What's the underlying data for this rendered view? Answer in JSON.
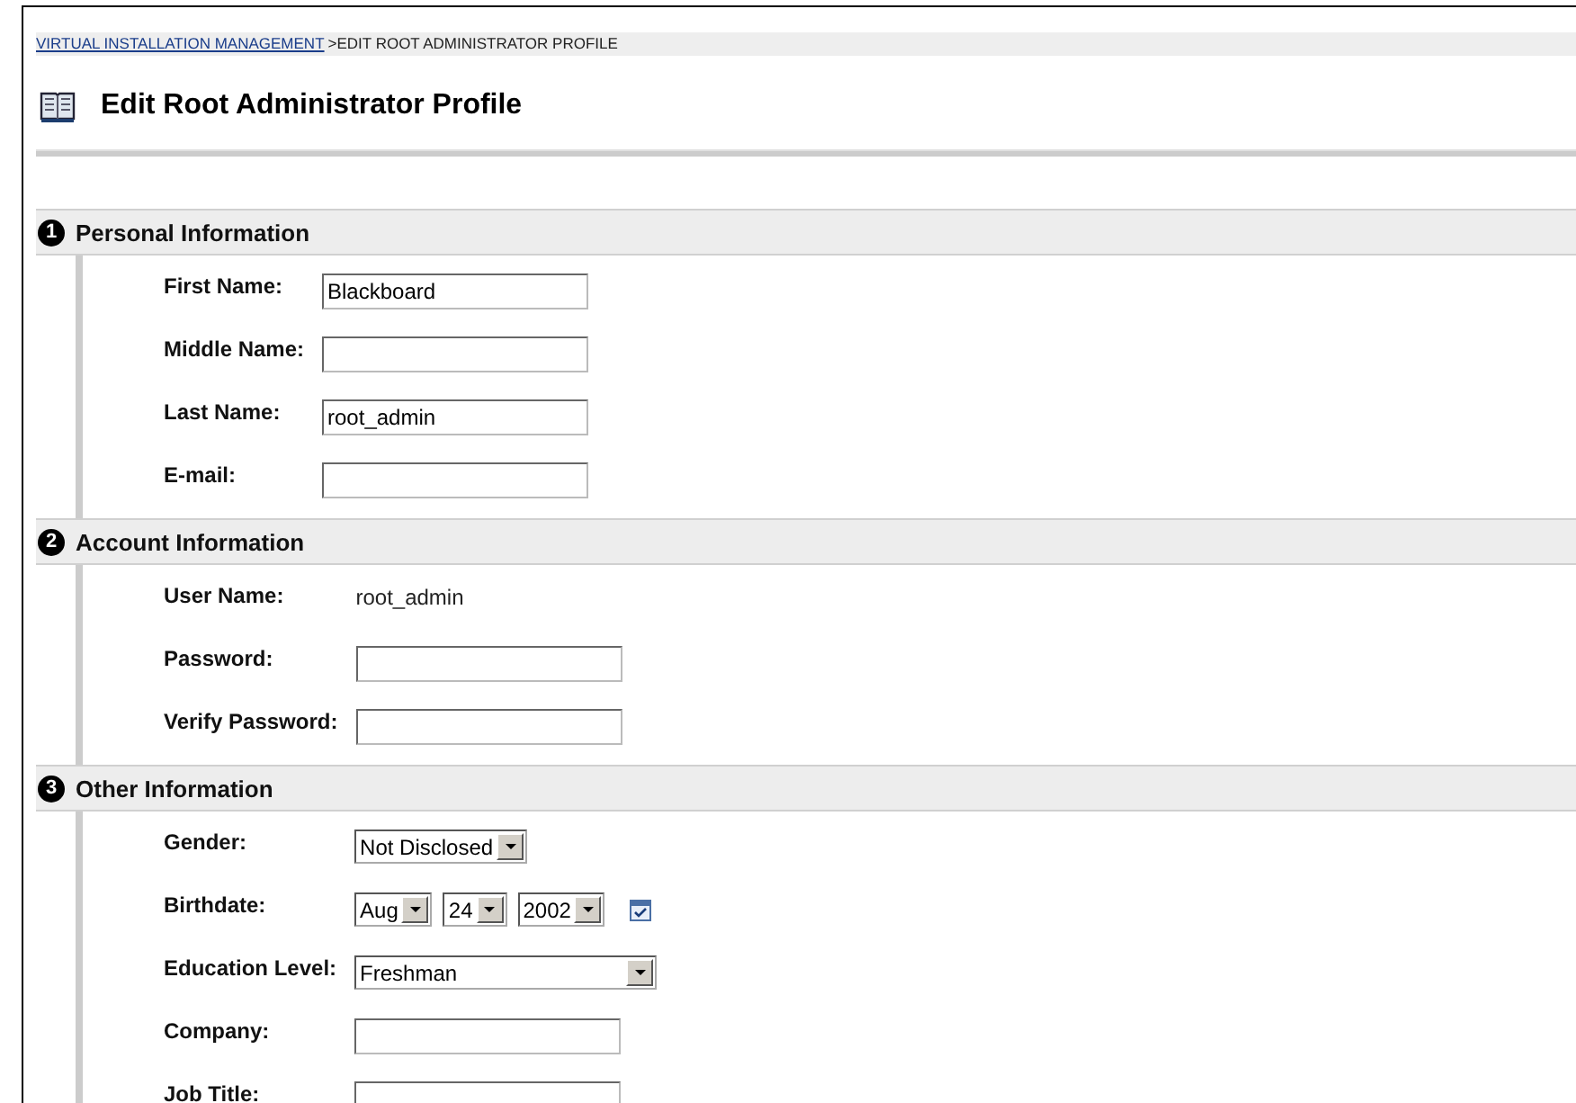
{
  "breadcrumb": {
    "link": "VIRTUAL INSTALLATION MANAGEMENT",
    "separator": ">",
    "current": "EDIT ROOT ADMINISTRATOR PROFILE"
  },
  "title": "Edit Root Administrator Profile",
  "sections": [
    {
      "number": "1",
      "title": "Personal Information",
      "rows": [
        {
          "kind": "text",
          "label": "First Name:",
          "value": "Blackboard"
        },
        {
          "kind": "text",
          "label": "Middle Name:"
        },
        {
          "kind": "text",
          "label": "Last Name:",
          "value": "root_admin"
        },
        {
          "kind": "text",
          "label": "E-mail:"
        }
      ]
    },
    {
      "number": "2",
      "title": "Account Information",
      "rows": [
        {
          "kind": "static",
          "label": "User Name:",
          "value": "root_admin"
        },
        {
          "kind": "text",
          "label": "Password:"
        },
        {
          "kind": "text",
          "label": "Verify Password:"
        }
      ]
    },
    {
      "number": "3",
      "title": "Other Information",
      "rows": [
        {
          "kind": "select",
          "label": "Gender:",
          "value": "Not Disclosed"
        },
        {
          "kind": "date",
          "label": "Birthdate:",
          "selects": [
            "Aug",
            "24",
            "2002"
          ]
        },
        {
          "kind": "select",
          "label": "Education Level:",
          "value": "Freshman",
          "wide": true
        },
        {
          "kind": "text",
          "label": "Company:"
        },
        {
          "kind": "text",
          "label": "Job Title:"
        }
      ]
    }
  ]
}
